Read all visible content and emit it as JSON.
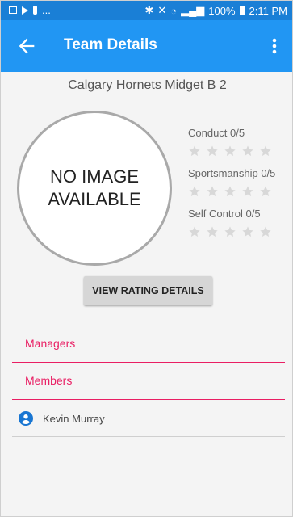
{
  "status_bar": {
    "left_text": "...",
    "battery": "100%",
    "time": "2:11 PM"
  },
  "app_bar": {
    "title": "Team Details",
    "back_icon": "arrow-left-icon",
    "menu_icon": "more-vert-icon"
  },
  "team": {
    "name": "Calgary Hornets Midget B 2"
  },
  "image_placeholder": {
    "line1": "NO IMAGE",
    "line2": "AVAILABLE"
  },
  "ratings": [
    {
      "label": "Conduct 0/5",
      "value": 0,
      "max": 5
    },
    {
      "label": "Sportsmanship 0/5",
      "value": 0,
      "max": 5
    },
    {
      "label": "Self Control 0/5",
      "value": 0,
      "max": 5
    }
  ],
  "view_rating_button": "VIEW RATING DETAILS",
  "sections": {
    "managers": "Managers",
    "members": "Members"
  },
  "members": [
    {
      "name": "Kevin Murray"
    }
  ],
  "colors": {
    "status_bar": "#1a7fd6",
    "app_bar": "#2196f3",
    "accent": "#e91e63",
    "star": "#d8d8d8"
  }
}
